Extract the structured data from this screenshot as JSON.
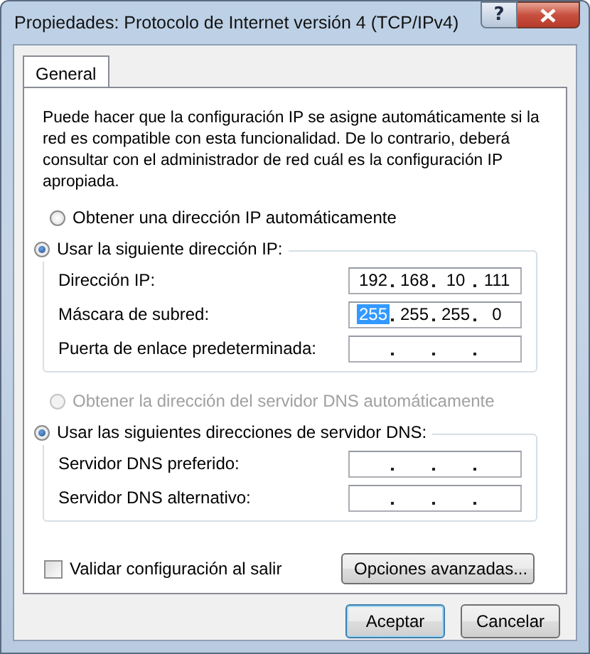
{
  "window": {
    "title": "Propiedades: Protocolo de Internet versión 4 (TCP/IPv4)"
  },
  "title_buttons": [
    {
      "kind": "help",
      "label": "?"
    },
    {
      "kind": "close"
    }
  ],
  "tabs": [
    {
      "label": "General",
      "selected": true
    }
  ],
  "intro": "Puede hacer que la configuración IP se asigne automáticamente si la red es compatible con esta funcionalidad. De lo contrario, deberá consultar con el administrador de red cuál es la configuración IP apropiada.",
  "ip_mode": [
    {
      "label": "Obtener una dirección IP automáticamente",
      "selected": false,
      "disabled": false
    },
    {
      "label": "Usar la siguiente dirección IP:",
      "selected": true,
      "disabled": false
    }
  ],
  "ip_fields": [
    {
      "label": "Dirección IP:",
      "octets": [
        {
          "text": "192",
          "selected": false
        },
        {
          "text": "168",
          "selected": false
        },
        {
          "text": "10",
          "selected": false
        },
        {
          "text": "111",
          "selected": false
        }
      ]
    },
    {
      "label": "Máscara de subred:",
      "octets": [
        {
          "text": "255",
          "selected": true
        },
        {
          "text": "255",
          "selected": false
        },
        {
          "text": "255",
          "selected": false
        },
        {
          "text": "0",
          "selected": false
        }
      ]
    },
    {
      "label": "Puerta de enlace predeterminada:"
    }
  ],
  "dns_mode": [
    {
      "label": "Obtener la dirección del servidor DNS automáticamente",
      "selected": false,
      "disabled": true
    },
    {
      "label": "Usar las siguientes direcciones de servidor DNS:",
      "selected": true,
      "disabled": false
    }
  ],
  "dns_fields": [
    {
      "label": "Servidor DNS preferido:"
    },
    {
      "label": "Servidor DNS alternativo:"
    }
  ],
  "validate_checkbox": {
    "label": "Validar configuración al salir",
    "checked": false
  },
  "advanced_button": "Opciones avanzadas...",
  "buttons": [
    {
      "label": "Aceptar",
      "default": true
    },
    {
      "label": "Cancelar",
      "default": false
    }
  ]
}
